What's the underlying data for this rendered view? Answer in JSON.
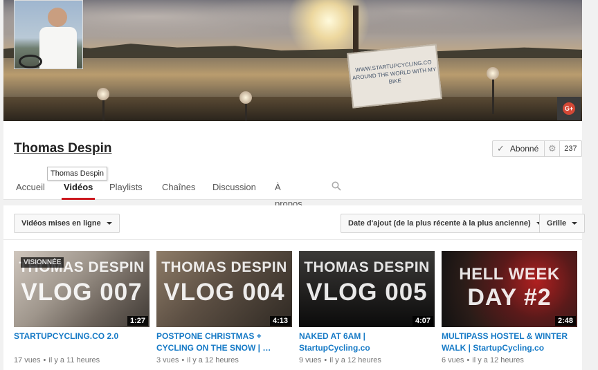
{
  "channel": {
    "name": "Thomas Despin",
    "tooltip": "Thomas Despin",
    "banner_sign_text": "WWW.STARTUPCYCLING.CO AROUND THE WORLD WITH MY BIKE",
    "subscribe": {
      "label": "Abonné",
      "count": "237"
    }
  },
  "tabs": [
    {
      "label": "Accueil",
      "active": false
    },
    {
      "label": "Vidéos",
      "active": true
    },
    {
      "label": "Playlists",
      "active": false
    },
    {
      "label": "Chaînes",
      "active": false
    },
    {
      "label": "Discussion",
      "active": false
    },
    {
      "label": "À propos",
      "active": false
    }
  ],
  "filters": {
    "type": "Vidéos mises en ligne",
    "sort": "Date d'ajout (de la plus récente à la plus ancienne)",
    "view": "Grille"
  },
  "videos": [
    {
      "thumb_line1": "THOMAS DESPIN",
      "thumb_line2": "VLOG 007",
      "badge": "VISIONNÉE",
      "duration": "1:27",
      "title": "STARTUPCYCLING.CO 2.0",
      "views": "17 vues",
      "age": "il y a 11 heures"
    },
    {
      "thumb_line1": "THOMAS DESPIN",
      "thumb_line2": "VLOG 004",
      "duration": "4:13",
      "title": "POSTPONE CHRISTMAS + CYCLING ON THE SNOW | …",
      "views": "3 vues",
      "age": "il y a 12 heures"
    },
    {
      "thumb_line1": "THOMAS DESPIN",
      "thumb_line2": "VLOG 005",
      "duration": "4:07",
      "title": "NAKED AT 6AM | StartupCycling.co",
      "views": "9 vues",
      "age": "il y a 12 heures"
    },
    {
      "thumb_line1": "HELL WEEK",
      "thumb_line2": "DAY #2",
      "duration": "2:48",
      "title": "MULTIPASS HOSTEL & WINTER WALK | StartupCycling.co",
      "views": "6 vues",
      "age": "il y a 12 heures"
    }
  ],
  "colors": {
    "accent": "#cc181e",
    "link": "#167ac6",
    "gplus": "#d34836"
  },
  "icons": {
    "gplus": "gplus-icon",
    "search": "search-icon",
    "check": "check-icon",
    "gear": "gear-icon"
  }
}
